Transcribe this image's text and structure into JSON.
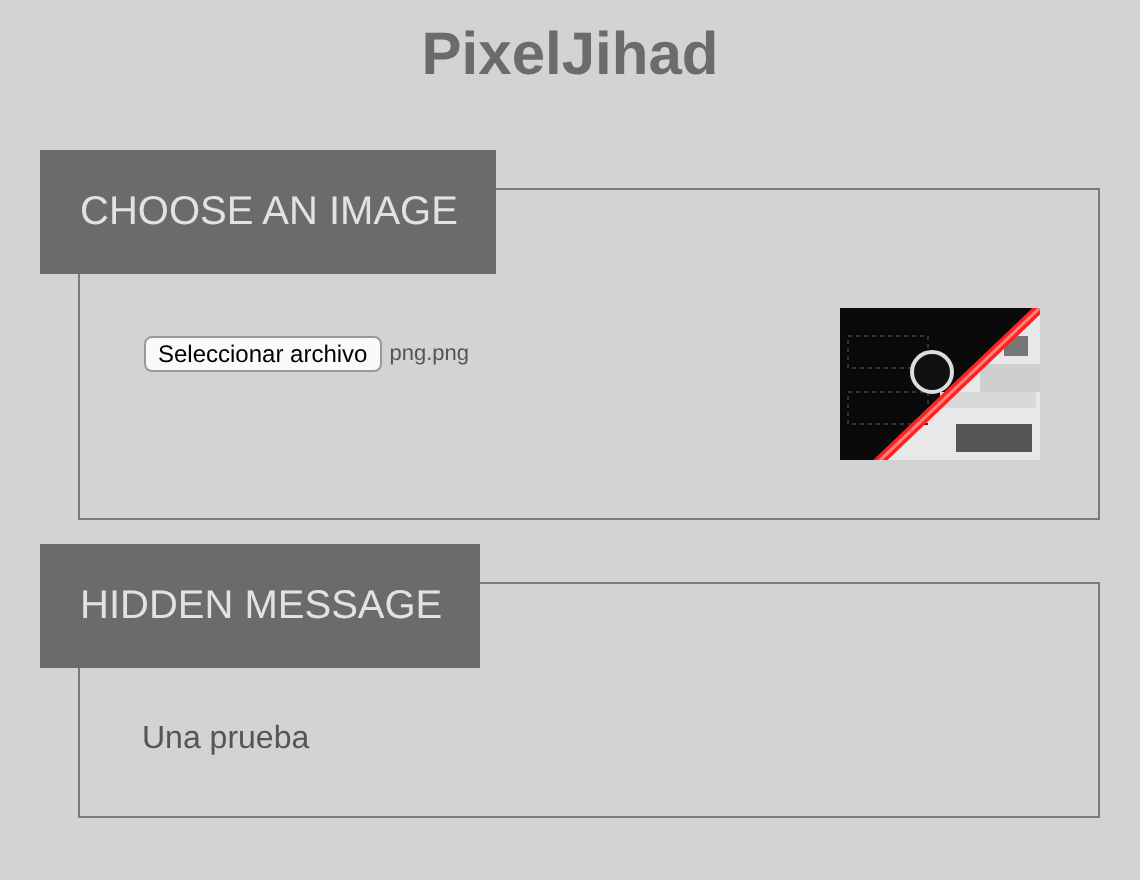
{
  "title": "PixelJihad",
  "sections": [
    {
      "kind": "file",
      "legend": "CHOOSE AN IMAGE",
      "button_label": "Seleccionar archivo",
      "file_name": "png.png"
    },
    {
      "kind": "text",
      "legend": "HIDDEN MESSAGE",
      "message": "Una prueba"
    }
  ]
}
